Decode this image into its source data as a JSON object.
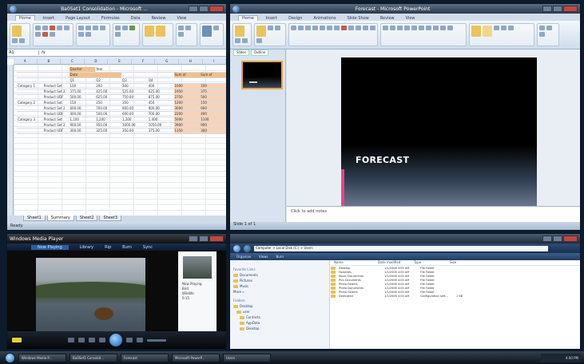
{
  "excel": {
    "title": "Ba0Set1 Consolidation - Microsoft ...",
    "tabs": [
      "Home",
      "Insert",
      "Page Layout",
      "Formulas",
      "Data",
      "Review",
      "View"
    ],
    "namebox": "A1",
    "rows": [
      [
        "",
        "",
        "Quarter",
        "Year",
        "",
        "",
        "",
        ""
      ],
      [
        "",
        "",
        "Data",
        "",
        "",
        "",
        "Sum of",
        "Sum of"
      ],
      [
        "",
        "",
        "Q1",
        "Q2",
        "Q3",
        "Q4",
        "",
        ""
      ],
      [
        "Category 1",
        "Product Set",
        "100",
        "200",
        "300",
        "400",
        "1000",
        "100"
      ],
      [
        "",
        "Product Set 2",
        "375.00",
        "425.00",
        "525.00",
        "625.00",
        "1950",
        "375"
      ],
      [
        "",
        "Product UDF",
        "500.00",
        "625.00",
        "750.00",
        "875.00",
        "2750",
        "500"
      ],
      [
        "Category 2",
        "Product Set",
        "150",
        "250",
        "350",
        "450",
        "1200",
        "150"
      ],
      [
        "",
        "Product Set 2",
        "600.00",
        "700.00",
        "800.00",
        "900.00",
        "3000",
        "600"
      ],
      [
        "",
        "Product UDF",
        "400.00",
        "500.00",
        "600.00",
        "700.00",
        "2200",
        "400"
      ],
      [
        "Category 3",
        "Product Set",
        "1,100",
        "1,200",
        "1,300",
        "1,400",
        "5000",
        "1100"
      ],
      [
        "",
        "Product Set 2",
        "900.00",
        "950.00",
        "1000.00",
        "1050.00",
        "3900",
        "900"
      ],
      [
        "",
        "Product UDF",
        "300.00",
        "325.00",
        "350.00",
        "375.00",
        "1350",
        "300"
      ]
    ],
    "sheet_tabs": [
      "Sheet1",
      "Summary",
      "Sheet2",
      "Sheet3"
    ],
    "status": "Ready"
  },
  "ppt": {
    "title": "Forecast - Microsoft PowerPoint",
    "tabs": [
      "Home",
      "Insert",
      "Design",
      "Animations",
      "Slide Show",
      "Review",
      "View"
    ],
    "panel_tabs": [
      "Slides",
      "Outline"
    ],
    "slide_title": "FORECAST",
    "notes_placeholder": "Click to add notes",
    "status": "Slide 1 of 1"
  },
  "wmp": {
    "title": "Windows Media Player",
    "nav": [
      "Now Playing",
      "Library",
      "Rip",
      "Burn",
      "Sync"
    ],
    "side_meta": [
      "Now Playing",
      "Bird",
      "Wildlife",
      "0:15"
    ]
  },
  "explorer": {
    "crumb": "Computer > Local Disk (C:) > Users",
    "tools": [
      "Organize",
      "Views",
      "Burn"
    ],
    "favorites_header": "Favorite Links",
    "favorites": [
      "Documents",
      "Pictures",
      "Music",
      "More »"
    ],
    "folders_header": "Folders",
    "tree": [
      "Desktop",
      "user",
      "Contacts",
      "AppData",
      "Desktop"
    ],
    "columns": [
      "Name",
      "Date modified",
      "Type",
      "Size"
    ],
    "files": [
      [
        "Desktop",
        "1/1/2008 4:00 AM",
        "File Folder",
        ""
      ],
      [
        "Favorites",
        "1/1/2008 4:00 AM",
        "File Folder",
        ""
      ],
      [
        "Music Documents",
        "1/1/2008 4:00 AM",
        "File Folder",
        ""
      ],
      [
        "Pics Documents",
        "1/1/2008 4:00 AM",
        "File Folder",
        ""
      ],
      [
        "Photo Folders",
        "1/1/2008 4:00 AM",
        "File Folder",
        ""
      ],
      [
        "Photo Documents",
        "1/1/2008 4:00 AM",
        "File Folder",
        ""
      ],
      [
        "Photo Folders",
        "1/1/2008 4:00 AM",
        "File Folder",
        ""
      ],
      [
        "Dedicated",
        "1/1/2008 4:00 AM",
        "Configuration sett...",
        "1 KB"
      ]
    ]
  },
  "taskbar": {
    "buttons": [
      "Windows Media P...",
      "Ba0Set1 Consolid...",
      "Forecast",
      "Microsoft PowerP...",
      "Users"
    ],
    "clock": "4:00 PM"
  }
}
